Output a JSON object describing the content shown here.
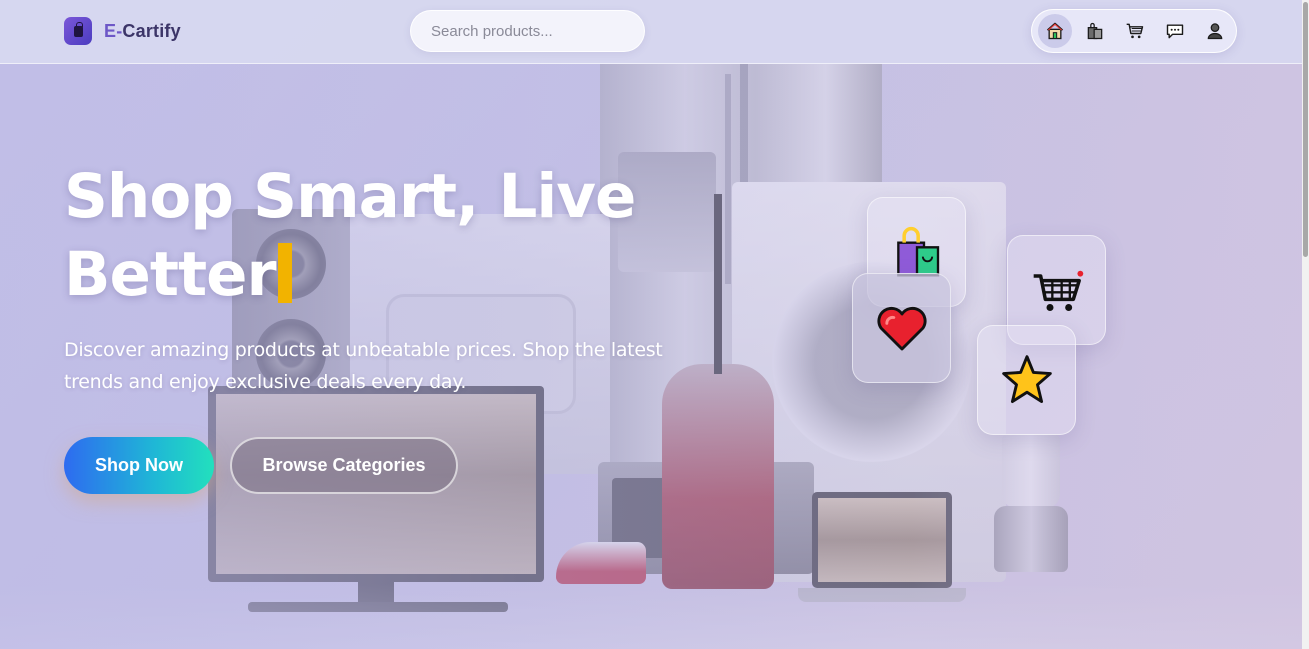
{
  "brand": {
    "letter": "E",
    "dash": "-",
    "name": "Cartify"
  },
  "search": {
    "placeholder": "Search products..."
  },
  "nav": {
    "items": [
      {
        "name": "home",
        "icon": "home-icon",
        "active": true
      },
      {
        "name": "products",
        "icon": "shopping-bags-icon",
        "active": false
      },
      {
        "name": "cart",
        "icon": "cart-icon",
        "active": false
      },
      {
        "name": "messages",
        "icon": "chat-icon",
        "active": false
      },
      {
        "name": "account",
        "icon": "user-icon",
        "active": false
      }
    ]
  },
  "hero": {
    "title_line1": "Shop Smart, Live",
    "title_line2": "Better",
    "subtitle": "Discover amazing products at unbeatable prices. Shop the latest trends and enjoy exclusive deals every day.",
    "primary_button": "Shop Now",
    "secondary_button": "Browse Categories"
  },
  "floating_icons": [
    "shopping-bags-icon",
    "heart-icon",
    "cart-icon",
    "star-icon"
  ],
  "colors": {
    "brand_accent": "#6d57c7",
    "caret": "#f2b300",
    "primary_gradient_start": "#2e6bf0",
    "primary_gradient_end": "#22e0bd",
    "heart": "#e8212e",
    "star": "#ffc31a"
  }
}
